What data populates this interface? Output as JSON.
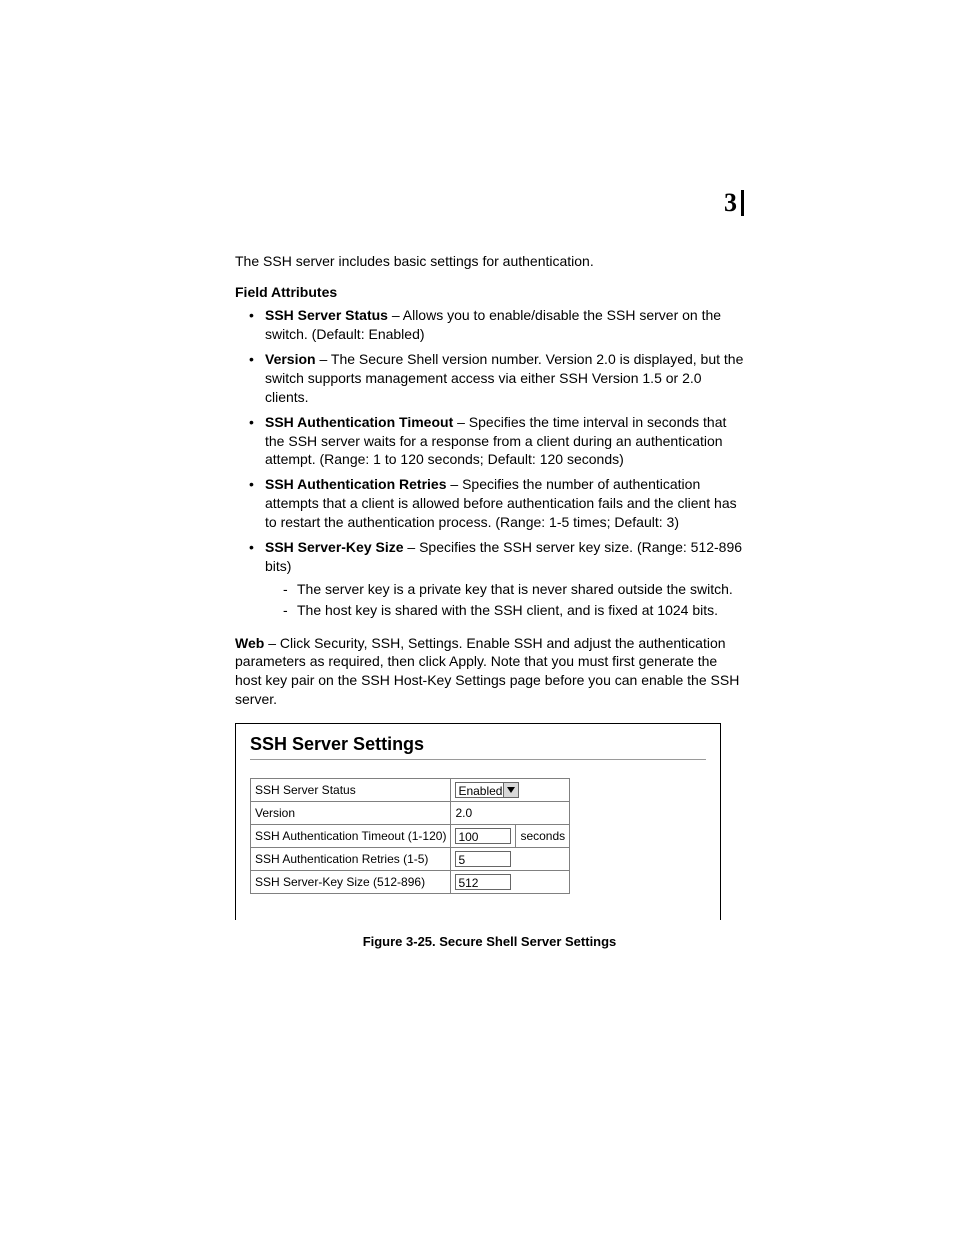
{
  "chapter": "3",
  "intro": "The SSH server includes basic settings for authentication.",
  "fieldAttributesHeading": "Field Attributes",
  "fields": [
    {
      "name": "SSH Server Status",
      "desc": " – Allows you to enable/disable the SSH server on the switch. (Default: Enabled)"
    },
    {
      "name": "Version",
      "desc": " – The Secure Shell version number. Version 2.0 is displayed, but the switch supports management access via either SSH Version 1.5 or 2.0 clients."
    },
    {
      "name": "SSH Authentication Timeout",
      "desc": " – Specifies the time interval in seconds that the SSH server waits for a response from a client during an authentication attempt. (Range: 1 to 120 seconds; Default: 120 seconds)"
    },
    {
      "name": "SSH Authentication Retries",
      "desc": " – Specifies the number of authentication attempts that a client is allowed before authentication fails and the client has to restart the authentication process. (Range: 1-5 times; Default: 3)"
    },
    {
      "name": "SSH Server-Key Size",
      "desc": " – Specifies the SSH server key size. (Range: 512-896 bits)",
      "sub": [
        "The server key is a private key that is never shared outside the switch.",
        "The host key is shared with the SSH client, and is fixed at 1024 bits."
      ]
    }
  ],
  "webLabel": "Web",
  "webNote": " – Click Security, SSH, Settings. Enable SSH and adjust the authentication parameters as required, then click Apply. Note that you must first generate the host key pair on the SSH Host-Key Settings page before you can enable the SSH server.",
  "panel": {
    "title": "SSH Server Settings",
    "rows": {
      "status": {
        "label": "SSH Server Status",
        "value": "Enabled"
      },
      "version": {
        "label": "Version",
        "value": "2.0"
      },
      "timeout": {
        "label": "SSH Authentication Timeout (1-120)",
        "value": "100",
        "unit": "seconds"
      },
      "retries": {
        "label": "SSH Authentication Retries (1-5)",
        "value": "5"
      },
      "keysize": {
        "label": "SSH Server-Key Size (512-896)",
        "value": "512"
      }
    }
  },
  "figureCaption": "Figure 3-25.  Secure Shell Server Settings"
}
